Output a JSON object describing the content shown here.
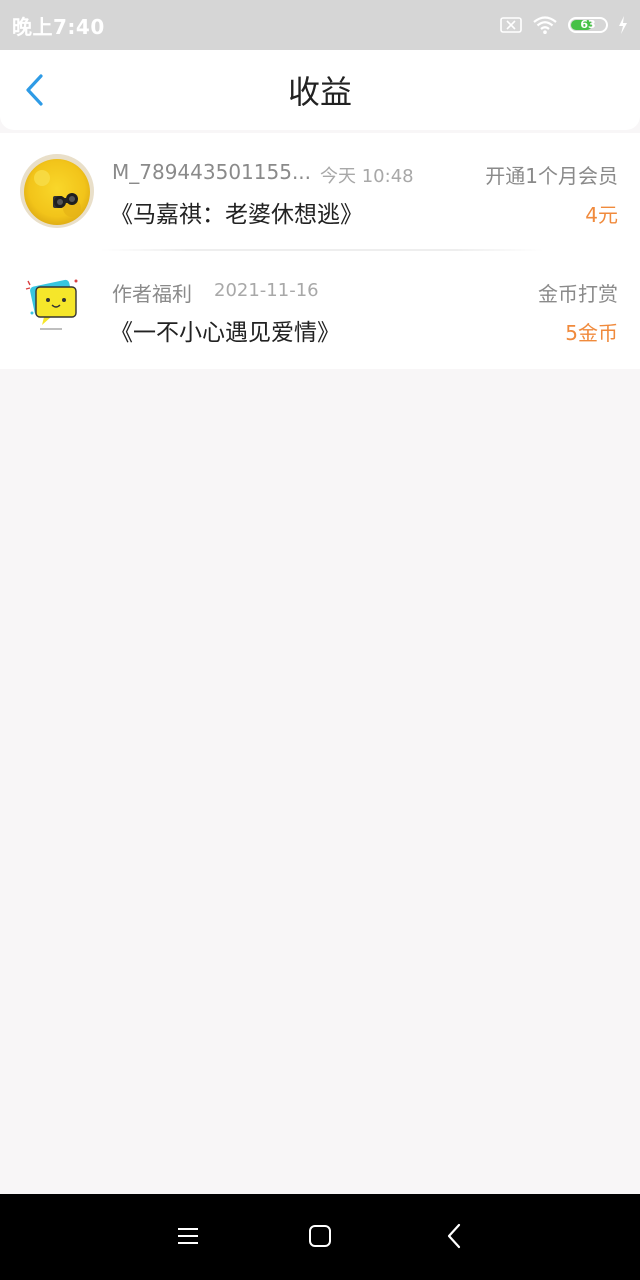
{
  "status_bar": {
    "time": "晚上7:40",
    "battery_level": "63",
    "battery_fraction": 0.63,
    "icons": [
      "sim-off-icon",
      "wifi-icon",
      "battery-icon",
      "charging-icon"
    ]
  },
  "header": {
    "title": "收益",
    "back_icon": "chevron-left-icon"
  },
  "records": [
    {
      "name": "M_789443501155...",
      "time": "今天 10:48",
      "type": "开通1个月会员",
      "book": "《马嘉祺：老婆休想逃》",
      "amount": "4元"
    },
    {
      "name": "作者福利",
      "time": "2021-11-16",
      "type": "金币打赏",
      "book": "《一不小心遇见爱情》",
      "amount": "5金币"
    }
  ],
  "colors": {
    "accent_blue": "#2e9be6",
    "amount_orange": "#f08a3c",
    "status_bar_bg": "#d6d6d6",
    "page_bg": "#f8f6f7"
  },
  "nav_bar": {
    "buttons": [
      "menu-icon",
      "home-icon",
      "back-icon"
    ]
  }
}
